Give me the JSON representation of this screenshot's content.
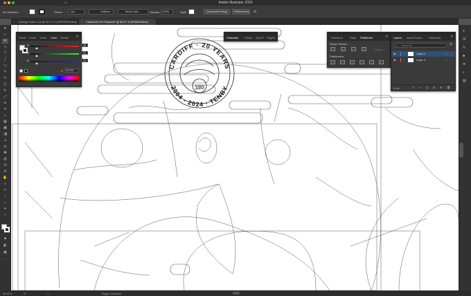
{
  "window": {
    "title": "Adobe Illustrator 2024",
    "traffic_lights": [
      "#fe5f57",
      "#febc2e",
      "#28c840"
    ]
  },
  "control_bar": {
    "selection_label": "No Selection",
    "stroke_label": "Stroke:",
    "stroke_value": "1 pt",
    "stroke_profile": "Uniform",
    "brush_name": "Touch Call...",
    "opacity_label": "Opacity:",
    "opacity_value": "100%",
    "style_label": "Style:",
    "document_setup": "Document Setup",
    "preferences": "Preferences"
  },
  "doc_tabs": [
    {
      "label": "Cycling Poster 1.ai @ 25.17 % (CMYK/Preview)",
      "active": false
    },
    {
      "label": "Cartes100-20 Postcard* @ 66.67 % (RGB/Outline)",
      "active": true
    }
  ],
  "color_panel": {
    "tabs": [
      "Swatc",
      "Gradi",
      "Trans",
      "Color",
      "Swatel"
    ],
    "active_tab": "Color",
    "channels": [
      {
        "label": "R",
        "value": "35"
      },
      {
        "label": "G",
        "value": "31"
      },
      {
        "label": "B",
        "value": "32"
      }
    ],
    "hex_prefix": "#",
    "hex": "231F20"
  },
  "character_panel": {
    "tabs": [
      "Character",
      "Parag",
      "OpenT",
      "Glyphs"
    ],
    "active_tab": "Character"
  },
  "pathfinder_panel": {
    "tabs": [
      "Transform",
      "Align",
      "Pathfinder"
    ],
    "active_tab": "Pathfinder",
    "shape_modes_label": "Shape Modes:",
    "pathfinders_label": "Pathfinders:",
    "expand_label": "Expand"
  },
  "layers_panel": {
    "tabs": [
      "Layers",
      "Asset Export",
      "Artboards"
    ],
    "active_tab": "Layers",
    "search_placeholder": "Search All",
    "layers": [
      {
        "name": "Layer 2",
        "selected": true,
        "color": "#4f8cff"
      },
      {
        "name": "Layer 4",
        "selected": false,
        "color": "#ff4f4f"
      }
    ],
    "footer_count": "2 La..."
  },
  "artwork": {
    "badge_top": "CARDIFF · 20 YEARS",
    "badge_bottom": "2004 - 2024 · TENBY",
    "badge_center": "100"
  },
  "status_bar": {
    "zoom": "66.67%",
    "rotation": "0°",
    "artboard": "1",
    "tool": "Toggle Selection"
  }
}
